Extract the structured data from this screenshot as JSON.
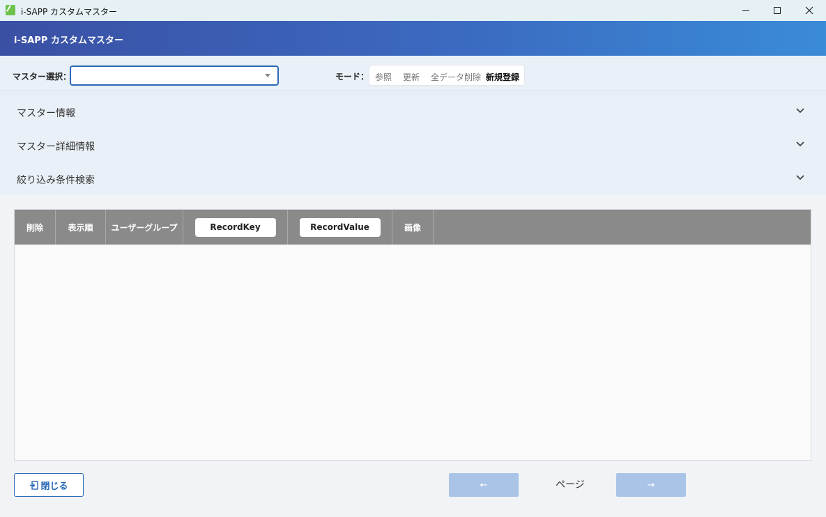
{
  "window": {
    "title": "i-SAPP カスタムマスター"
  },
  "header": {
    "title": "i-SAPP カスタムマスター"
  },
  "controls": {
    "master_label": "マスター選択：",
    "master_value": "",
    "mode_label": "モード：",
    "modes": [
      "参照",
      "更新",
      "全データ削除",
      "新規登録"
    ],
    "active_mode": "新規登録"
  },
  "accordions": [
    {
      "label": "マスター情報"
    },
    {
      "label": "マスター詳細情報"
    },
    {
      "label": "絞り込み条件検索"
    }
  ],
  "table": {
    "columns": [
      "削除",
      "表示順",
      "ユーザーグループ",
      "RecordKey",
      "RecordValue",
      "画像"
    ],
    "rows": []
  },
  "footer": {
    "close_label": "閉じる",
    "prev_label": "←",
    "page_label": "ページ",
    "next_label": "→"
  },
  "colors": {
    "accent": "#2a6ab8",
    "header_start": "#3a50a4",
    "header_end": "#3a8bd8",
    "table_header": "#8a8a8a",
    "pager_disabled": "#a9c4e6"
  }
}
